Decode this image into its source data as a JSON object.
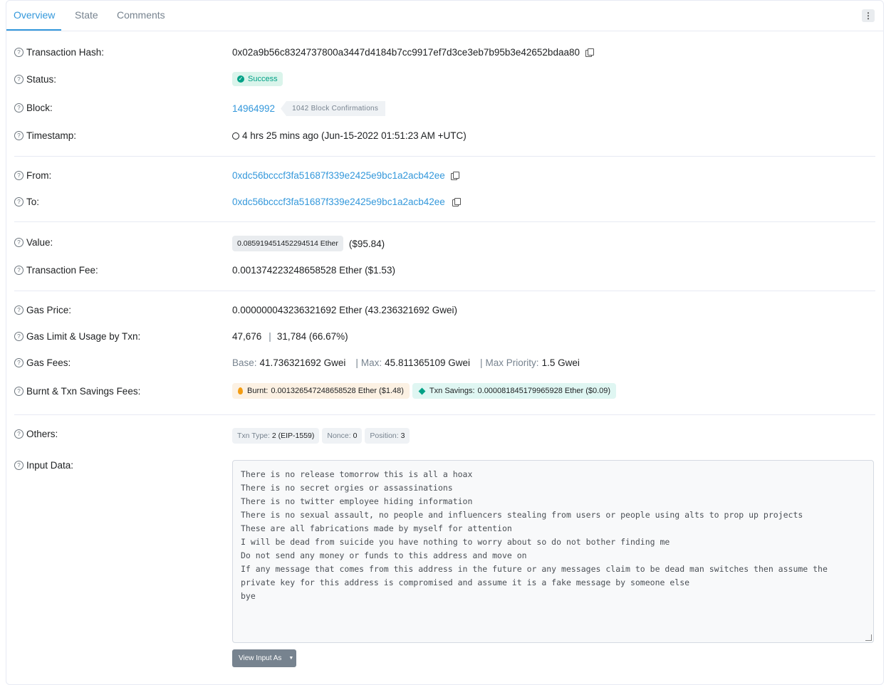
{
  "tabs": [
    {
      "label": "Overview"
    },
    {
      "label": "State"
    },
    {
      "label": "Comments"
    }
  ],
  "more_icon": "⋮",
  "rows": {
    "tx_hash": {
      "label": "Transaction Hash:",
      "value": "0x02a9b56c8324737800a3447d4184b7cc9917ef7d3ce3eb7b95b3e42652bdaa80"
    },
    "status": {
      "label": "Status:",
      "value": "Success"
    },
    "block": {
      "label": "Block:",
      "value": "14964992",
      "confirmations": "1042 Block Confirmations"
    },
    "timestamp": {
      "label": "Timestamp:",
      "value": "4 hrs 25 mins ago (Jun-15-2022 01:51:23 AM +UTC)"
    },
    "from": {
      "label": "From:",
      "value": "0xdc56bcccf3fa51687f339e2425e9bc1a2acb42ee"
    },
    "to": {
      "label": "To:",
      "value": "0xdc56bcccf3fa51687f339e2425e9bc1a2acb42ee"
    },
    "value": {
      "label": "Value:",
      "amount": "0.085919451452294514 Ether",
      "usd": "($95.84)"
    },
    "fee": {
      "label": "Transaction Fee:",
      "value": "0.001374223248658528 Ether ($1.53)"
    },
    "gas_price": {
      "label": "Gas Price:",
      "value": "0.000000043236321692 Ether (43.236321692 Gwei)"
    },
    "gas_limit": {
      "label": "Gas Limit & Usage by Txn:",
      "limit": "47,676",
      "separator": "|",
      "usage": "31,784 (66.67%)"
    },
    "gas_fees": {
      "label": "Gas Fees:",
      "base_label": "Base:",
      "base_value": "41.736321692 Gwei",
      "max_label": "Max:",
      "max_value": "45.811365109 Gwei",
      "priority_label": "Max Priority:",
      "priority_value": "1.5 Gwei",
      "separator": "|"
    },
    "burnt": {
      "label": "Burnt & Txn Savings Fees:",
      "burnt_label": "Burnt:",
      "burnt_value": "0.001326547248658528 Ether ($1.48)",
      "savings_label": "Txn Savings:",
      "savings_value": "0.000081845179965928 Ether ($0.09)"
    },
    "others": {
      "label": "Others:",
      "txn_type_label": "Txn Type:",
      "txn_type_value": "2 (EIP-1559)",
      "nonce_label": "Nonce:",
      "nonce_value": "0",
      "position_label": "Position:",
      "position_value": "3"
    },
    "input": {
      "label": "Input Data:",
      "lines": [
        "There is no release tomorrow this is all a hoax",
        "There is no secret orgies or assassinations",
        "There is no twitter employee hiding information",
        "There is no sexual assault, no people and influencers stealing from users or people using alts to prop up projects",
        "These are all fabrications made by myself for attention",
        "I will be dead from suicide you have nothing to worry about so do not bother finding me",
        "Do not send any money or funds to this address and move on",
        "If any message that comes from this address in the future or any messages claim to be dead man switches then assume the private key for this address is compromised and assume it is a fake message by someone else",
        "bye"
      ],
      "view_button": "View Input As"
    }
  },
  "colors": {
    "link": "#3498db",
    "success": "#00a186",
    "burnt": "#f39c12"
  }
}
